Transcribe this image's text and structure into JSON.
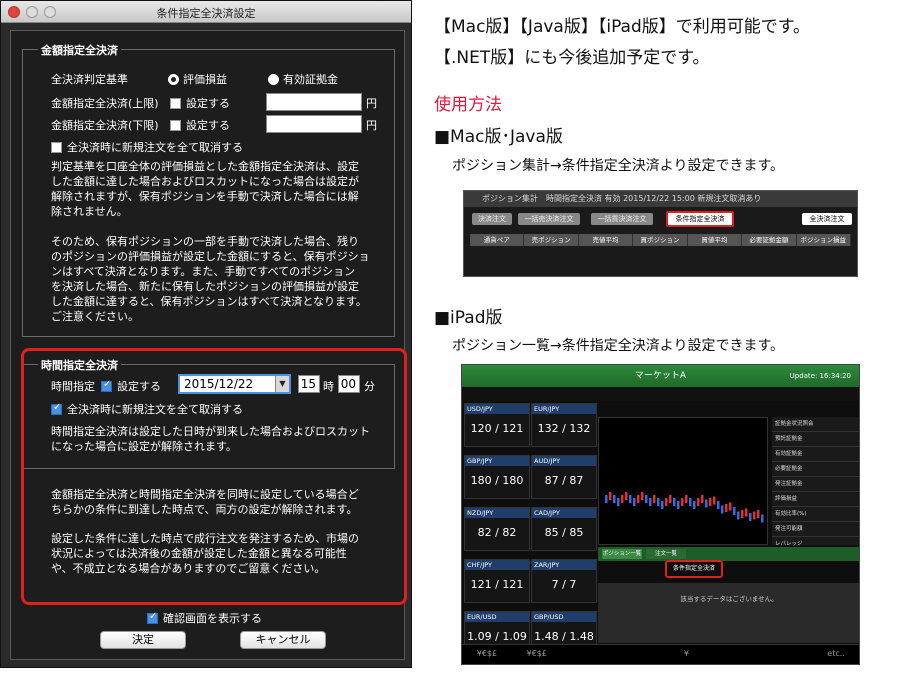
{
  "dialog": {
    "title": "条件指定全決済設定",
    "amount": {
      "legend": "金額指定全決済",
      "criteria_label": "全決済判定基準",
      "radio_eval": "評価損益",
      "radio_margin": "有効証拠金",
      "upper_label": "金額指定全決済(上限)",
      "upper_check": "設定する",
      "lower_label": "金額指定全決済(下限)",
      "lower_check": "設定する",
      "unit": "円",
      "cancel_new": "全決済時に新規注文を全て取消する",
      "p1": [
        "判定基準を口座全体の評価損益とした金額指定全決済は、設定",
        "した金額に達した場合およびロスカットになった場合は設定が",
        "解除されますが、保有ポジションを手動で決済した場合には解",
        "除されません。"
      ],
      "p2": [
        "そのため、保有ポジションの一部を手動で決済した場合、残り",
        "のポジションの評価損益が設定した金額にすると、保有ポジショ",
        "ンはすべて決済となります。また、手動ですべてのポジション",
        "を決済した場合、新たに保有したポジションの評価損益が設定",
        "した金額に達すると、保有ポジションはすべて決済となります。",
        "ご注意ください。"
      ]
    },
    "time": {
      "legend": "時間指定全決済",
      "time_label": "時間指定",
      "set_label": "設定する",
      "date": "2015/12/22",
      "hour": "15",
      "hour_unit": "時",
      "minute": "00",
      "minute_unit": "分",
      "cancel_new": "全決済時に新規注文を全て取消する",
      "p1": [
        "時間指定全決済は設定した日時が到来した場合およびロスカット",
        "になった場合に設定が解除されます。"
      ]
    },
    "note1": [
      "金額指定全決済と時間指定全決済を同時に設定している場合ど",
      "ちらかの条件に到達した時点で、両方の設定が解除されます。"
    ],
    "note2": [
      "設定した条件に達した時点で成行注文を発注するため、市場の",
      "状況によっては決済後の金額が設定した金額と異なる可能性",
      "や、不成立となる場合がありますのでご留意ください。"
    ],
    "confirm_label": "確認画面を表示する",
    "ok_button": "決定",
    "cancel_button": "キャンセル"
  },
  "right": {
    "line1": "【Mac版】【Java版】【iPad版】で利用可能です。",
    "line2": "【.NET版】にも今後追加予定です。",
    "usage_heading": "使用方法",
    "mac_heading": "■Mac版･Java版",
    "mac_desc": "ポジション集計→条件指定全決済より設定できます。",
    "ipad_heading": "■iPad版",
    "ipad_desc": "ポジション一覧→条件指定全決済より設定できます。"
  },
  "mac_shot": {
    "title": "ポジション集計　時間指定全決済 有効 2015/12/22 15:00 新規注文取消あり",
    "buttons": [
      "決済注文",
      "一括売決済注文",
      "一括買決済注文",
      "条件指定全決済",
      "全決済注文"
    ],
    "columns": [
      "通貨ペア",
      "売ポジション",
      "売値平均",
      "買ポジション",
      "買値平均",
      "必要証拠金額",
      "ポジション損益"
    ]
  },
  "ipad_shot": {
    "title": "マーケットA",
    "update": "Update: 16:34:20",
    "tabs": [
      "ポジション一覧",
      "注文一覧"
    ],
    "highlight": "条件指定全決済",
    "empty": "該当するデータはございません。",
    "nav": [
      "¥€$£",
      "¥€$£",
      "",
      "",
      "¥",
      "",
      "",
      "etc.."
    ],
    "quotes": [
      {
        "pair": "USD/JPY",
        "bid": "120",
        "ask": "121"
      },
      {
        "pair": "EUR/JPY",
        "bid": "132",
        "ask": "132"
      },
      {
        "pair": "GBP/JPY",
        "bid": "180",
        "ask": "180"
      },
      {
        "pair": "AUD/JPY",
        "bid": "87",
        "ask": "87"
      },
      {
        "pair": "NZD/JPY",
        "bid": "82",
        "ask": "82"
      },
      {
        "pair": "CAD/JPY",
        "bid": "85",
        "ask": "85"
      },
      {
        "pair": "CHF/JPY",
        "bid": "121",
        "ask": "121"
      },
      {
        "pair": "ZAR/JPY",
        "bid": "7",
        "ask": "7"
      },
      {
        "pair": "EUR/USD",
        "bid": "1.09",
        "ask": "1.09"
      },
      {
        "pair": "GBP/USD",
        "bid": "1.48",
        "ask": "1.48"
      }
    ],
    "side": [
      "証拠金状況照会",
      "預託証拠金",
      "有効証拠金",
      "必要証拠金",
      "発注証拠金",
      "評価損益",
      "有効比率(%)",
      "発注可能額",
      "レバレッジ"
    ]
  }
}
